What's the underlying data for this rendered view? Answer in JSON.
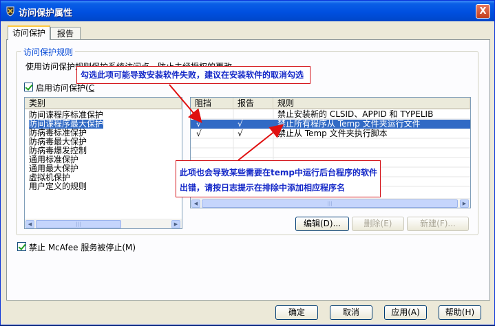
{
  "window": {
    "title": "访问保护属性",
    "close_label": "X"
  },
  "tabs": [
    {
      "label": "访问保护"
    },
    {
      "label": "报告"
    }
  ],
  "group": {
    "title": "访问保护规则",
    "description": "使用访问保护规则保护系统访问点，防止未经授权的更改。",
    "enable_label": "启用访问保护(",
    "enable_accel": "C"
  },
  "categories": {
    "header": "类别",
    "items": [
      "防间谍程序标准保护",
      "防间谍程序最大保护",
      "防病毒标准保护",
      "防病毒最大保护",
      "防病毒爆发控制",
      "通用标准保护",
      "通用最大保护",
      "虚拟机保护",
      "用户定义的规则"
    ],
    "selected_index": 1
  },
  "rules": {
    "headers": {
      "block": "阻挡",
      "report": "报告",
      "rule": "规则"
    },
    "rows": [
      {
        "block": "",
        "report": "",
        "rule": "禁止安装新的 CLSID、APPID 和 TYPELIB"
      },
      {
        "block": "√",
        "report": "√",
        "rule": "禁止所有程序从 Temp 文件夹运行文件"
      },
      {
        "block": "√",
        "report": "√",
        "rule": "禁止从 Temp 文件夹执行脚本"
      }
    ],
    "selected_index": 1
  },
  "buttons": {
    "edit": "编辑(D)...",
    "delete": "删除(E)",
    "new": "新建(F)..."
  },
  "bottom_checkbox": {
    "label": "禁止 McAfee 服务被停止(M)"
  },
  "dialog_buttons": {
    "ok": "确定",
    "cancel": "取消",
    "apply": "应用(A)",
    "help": "帮助(H)"
  },
  "annotations": {
    "callout1": "勾选此项可能导致安装软件失败，建议在安装软件的取消勾选",
    "callout2_line1": "此项也会导致某些需要在temp中运行后台程序的软件",
    "callout2_line2": "出错，请按日志提示在排除中添加相应程序名"
  },
  "colors": {
    "title_bar": "#0050e0",
    "selection": "#316ac5",
    "callout_border": "#d4141a",
    "callout_text": "#1428c8",
    "arrow": "#e01010"
  }
}
